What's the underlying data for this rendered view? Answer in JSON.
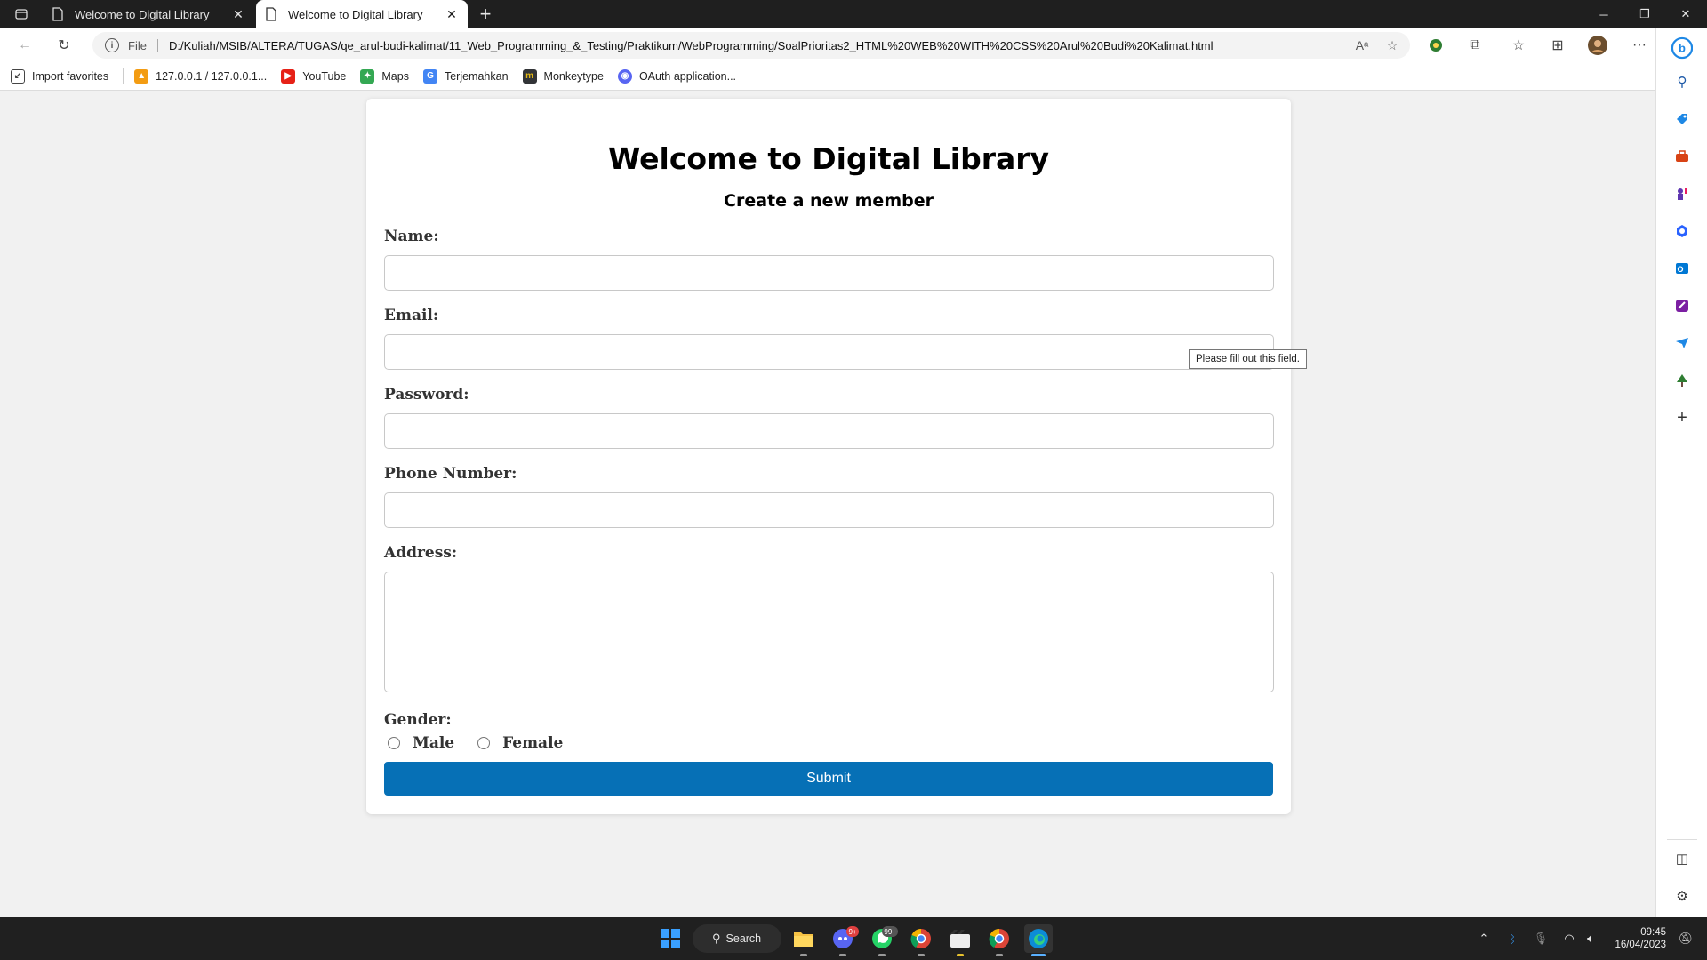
{
  "browser": {
    "tabs": [
      {
        "title": "Welcome to Digital Library",
        "active": false
      },
      {
        "title": "Welcome to Digital Library",
        "active": true
      }
    ],
    "address": {
      "scheme": "File",
      "url": "D:/Kuliah/MSIB/ALTERA/TUGAS/qe_arul-budi-kalimat/11_Web_Programming_&_Testing/Praktikum/WebProgramming/SoalPrioritas2_HTML%20WEB%20WITH%20CSS%20Arul%20Budi%20Kalimat.html"
    },
    "bookmarks": [
      {
        "label": "Import favorites",
        "icon": "import-icon"
      },
      {
        "label": "127.0.0.1 / 127.0.0.1...",
        "icon": "phpmyadmin-icon"
      },
      {
        "label": "YouTube",
        "icon": "youtube-icon"
      },
      {
        "label": "Maps",
        "icon": "maps-icon"
      },
      {
        "label": "Terjemahkan",
        "icon": "translate-icon"
      },
      {
        "label": "Monkeytype",
        "icon": "monkeytype-icon"
      },
      {
        "label": "OAuth application...",
        "icon": "discord-icon"
      }
    ]
  },
  "page": {
    "title": "Welcome to Digital Library",
    "subtitle": "Create a new member",
    "fields": {
      "name": {
        "label": "Name:",
        "value": ""
      },
      "email": {
        "label": "Email:",
        "value": ""
      },
      "password": {
        "label": "Password:",
        "value": ""
      },
      "phone": {
        "label": "Phone Number:",
        "value": ""
      },
      "address": {
        "label": "Address:",
        "value": ""
      }
    },
    "gender": {
      "label": "Gender:",
      "options": [
        "Male",
        "Female"
      ]
    },
    "submit_label": "Submit",
    "validation_tooltip": "Please fill out this field."
  },
  "taskbar": {
    "search_label": "Search",
    "discord_badge": "9+",
    "whatsapp_badge": "99+",
    "time": "09:45",
    "date": "16/04/2023"
  },
  "colors": {
    "submit_bg": "#0670b6",
    "page_bg": "#f1f1f1",
    "taskbar_bg": "#202020"
  }
}
